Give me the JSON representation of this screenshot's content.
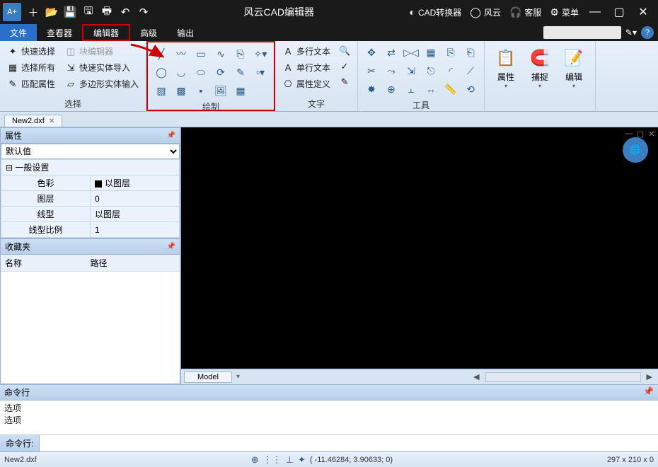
{
  "titlebar": {
    "app_title": "风云CAD编辑器",
    "right_links": {
      "converter": "CAD转换器",
      "brand": "风云",
      "service": "客服",
      "menu": "菜单"
    }
  },
  "menubar": {
    "items": [
      "文件",
      "查看器",
      "编辑器",
      "高级",
      "输出"
    ]
  },
  "ribbon": {
    "group_select": {
      "label": "选择",
      "items_left": [
        "快速选择",
        "选择所有",
        "匹配属性"
      ],
      "items_right": [
        "块编辑器",
        "快速实体导入",
        "多边形实体输入"
      ]
    },
    "group_draw": {
      "label": "绘制"
    },
    "group_text": {
      "label": "文字",
      "items": [
        "多行文本",
        "单行文本",
        "属性定义"
      ]
    },
    "group_tools": {
      "label": "工具"
    },
    "group_edit": {
      "big_items": [
        "属性",
        "捕捉",
        "编辑"
      ]
    }
  },
  "doctab": {
    "name": "New2.dxf"
  },
  "panels": {
    "props": {
      "title": "属性",
      "default_select": "默认值",
      "section": "一般设置",
      "rows": {
        "color_k": "色彩",
        "color_v": "以图层",
        "layer_k": "图层",
        "layer_v": "0",
        "ltype_k": "线型",
        "ltype_v": "以图层",
        "lscale_k": "线型比例",
        "lscale_v": "1"
      }
    },
    "fav": {
      "title": "收藏夹",
      "col_name": "名称",
      "col_path": "路径"
    }
  },
  "model_tab": "Model",
  "cmd": {
    "title": "命令行",
    "history1": "选项",
    "history2": "选项",
    "prompt": "命令行:"
  },
  "status": {
    "file": "New2.dxf",
    "coords": "( -11.46284; 3.90633; 0)",
    "dims": "297 x 210 x 0"
  }
}
